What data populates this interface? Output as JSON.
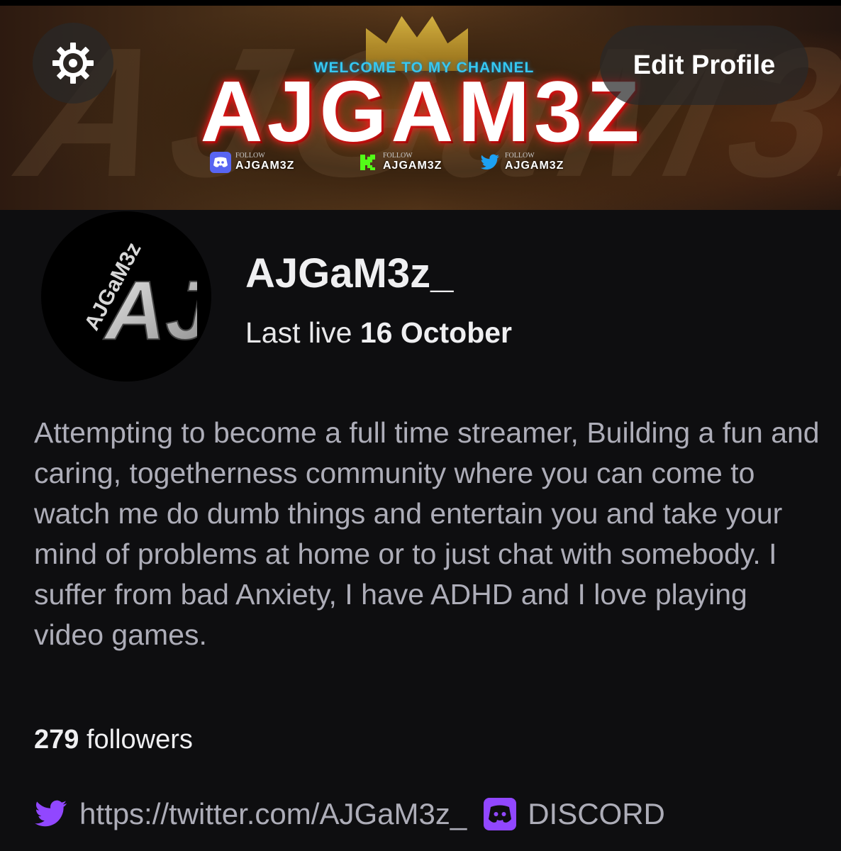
{
  "banner": {
    "background_text": "AJGaM3z",
    "welcome_text": "WELCOME TO MY CHANNEL",
    "title": "AJGAM3Z",
    "follow_small_label": "FOLLOW",
    "follow_links": [
      {
        "icon": "discord-icon",
        "name": "AJGAM3Z",
        "color": "#5865f2"
      },
      {
        "icon": "kick-icon",
        "name": "AJGAM3Z",
        "color": "#53fc18"
      },
      {
        "icon": "twitter-icon",
        "name": "AJGAM3Z",
        "color": "#1da1f2"
      }
    ]
  },
  "toolbar": {
    "settings_icon": "gear-icon",
    "edit_profile_label": "Edit Profile"
  },
  "profile": {
    "avatar_text": "AJGaM3z",
    "avatar_monogram": "AJ",
    "username": "AJGaM3z_",
    "last_live_prefix": "Last live",
    "last_live_date": "16 October",
    "bio": "Attempting to become a full time streamer, Building a fun and caring, togetherness community where you can come to watch me do dumb things and entertain you and take your mind of problems at home or to just chat with somebody. I suffer from bad Anxiety, I have ADHD and I love playing video games.",
    "followers_count": "279",
    "followers_label": "followers"
  },
  "social_links": [
    {
      "icon": "twitter-icon",
      "label": "https://twitter.com/AJGaM3z_"
    },
    {
      "icon": "discord-icon",
      "label": "DISCORD"
    }
  ],
  "colors": {
    "background": "#0e0e10",
    "accent_purple": "#9147ff",
    "bio_text": "#adadb8",
    "title_glow": "#e01818",
    "welcome_cyan": "#35c8f2"
  }
}
